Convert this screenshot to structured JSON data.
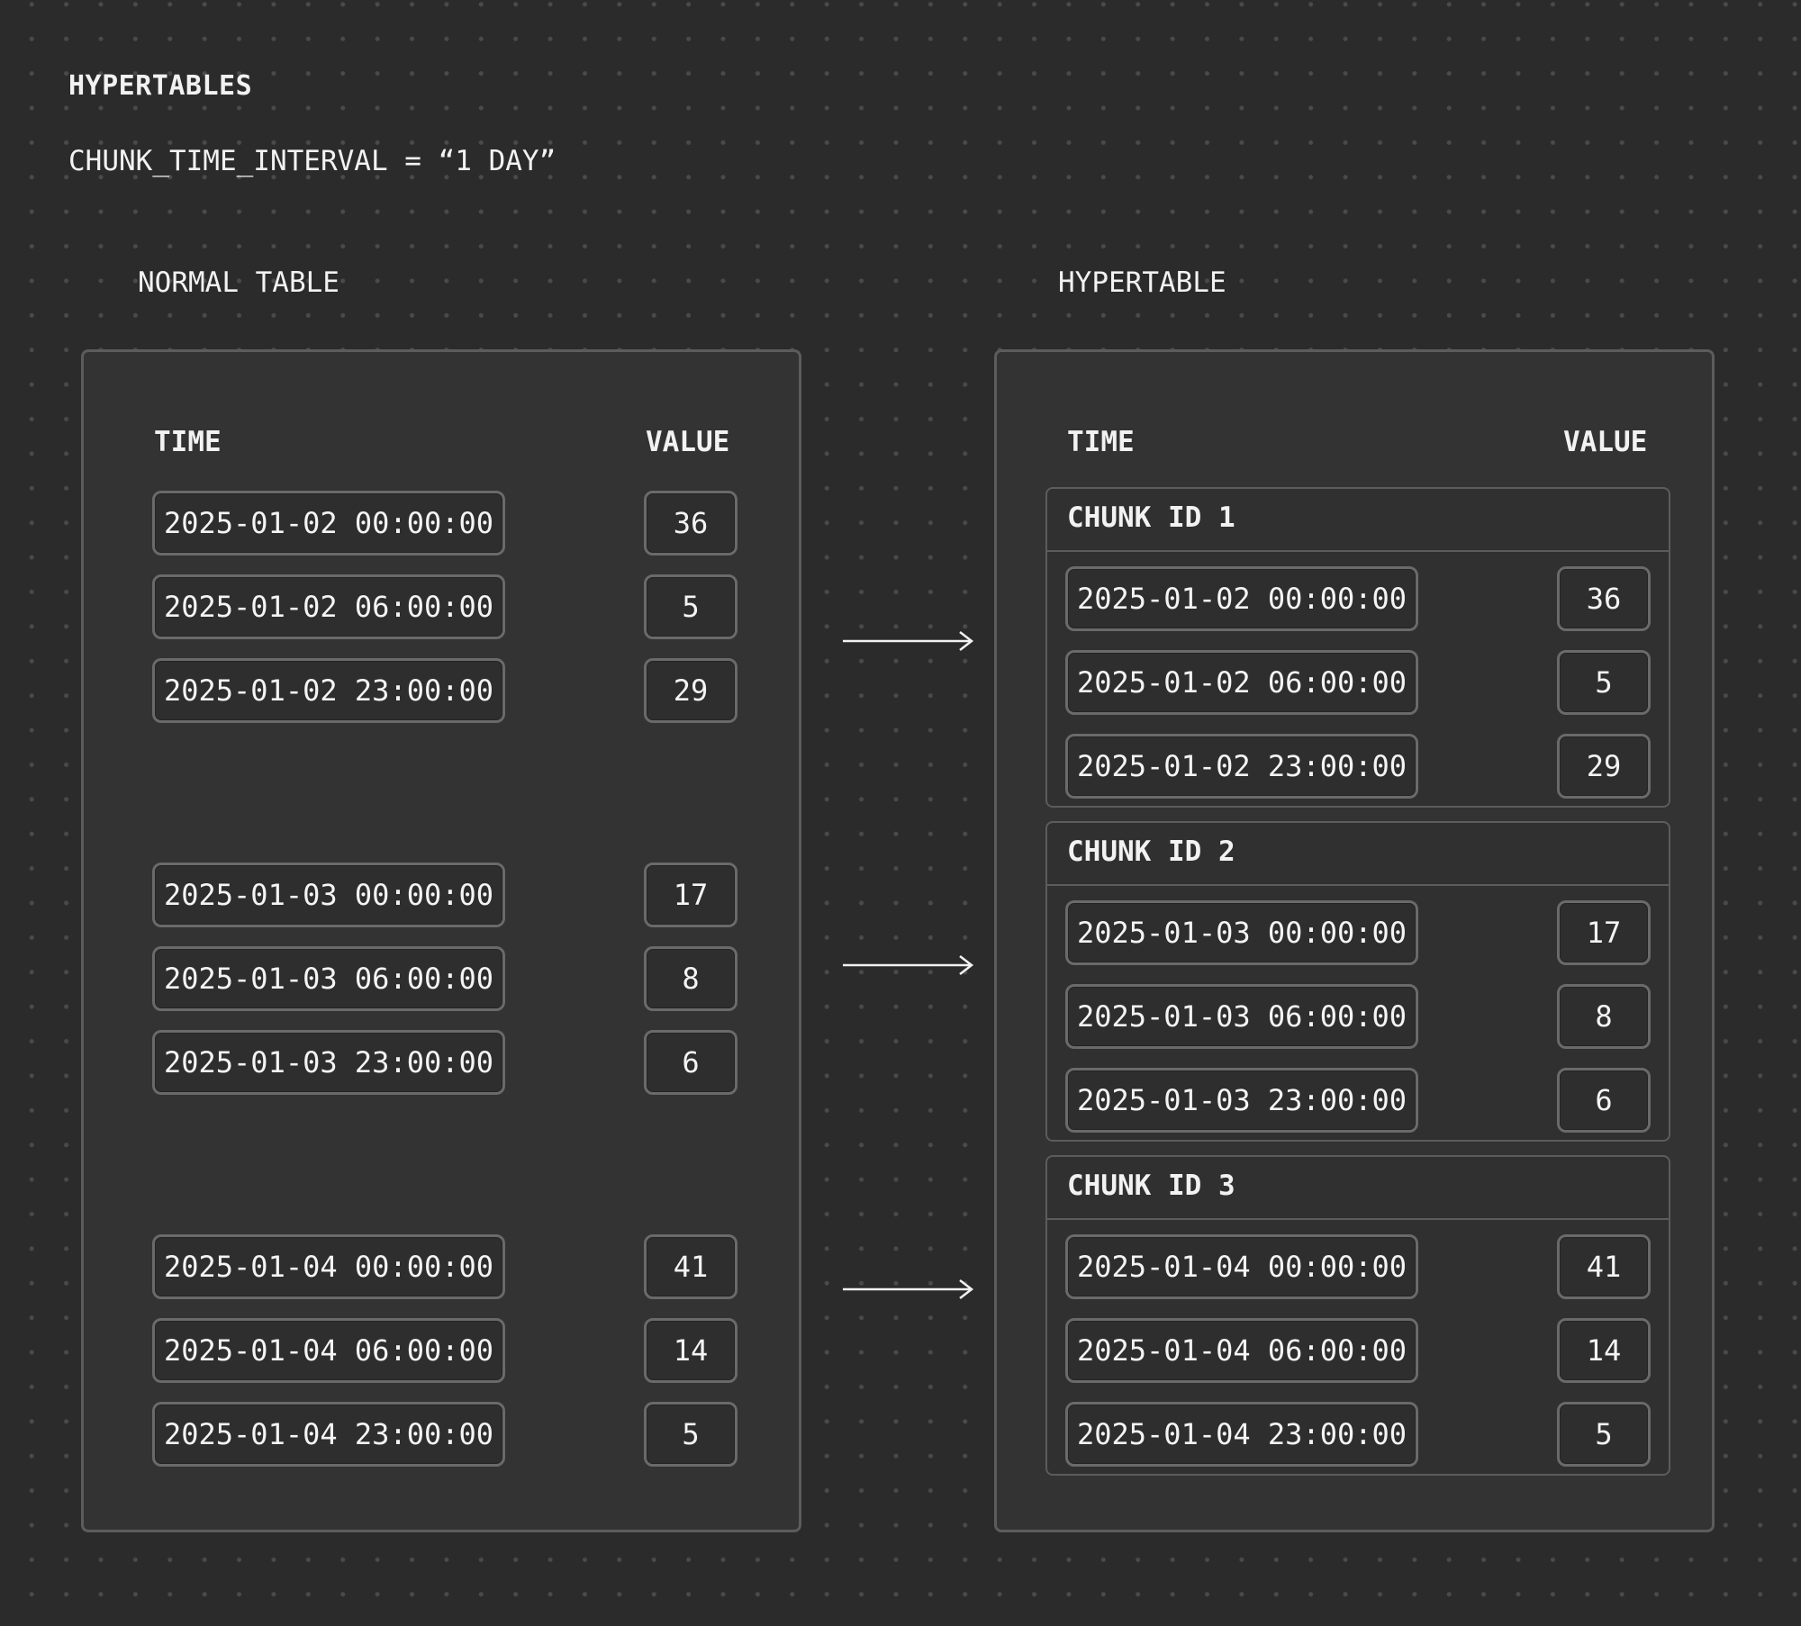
{
  "header": {
    "title": "HYPERTABLES",
    "subtitle": "CHUNK_TIME_INTERVAL = “1 DAY”"
  },
  "normal_table": {
    "label": "NORMAL TABLE",
    "col_time": "TIME",
    "col_value": "VALUE",
    "rows": [
      {
        "time": "2025-01-02 00:00:00",
        "value": "36"
      },
      {
        "time": "2025-01-02 06:00:00",
        "value": "5"
      },
      {
        "time": "2025-01-02 23:00:00",
        "value": "29"
      },
      {
        "time": "2025-01-03 00:00:00",
        "value": "17"
      },
      {
        "time": "2025-01-03 06:00:00",
        "value": "8"
      },
      {
        "time": "2025-01-03 23:00:00",
        "value": "6"
      },
      {
        "time": "2025-01-04 00:00:00",
        "value": "41"
      },
      {
        "time": "2025-01-04 06:00:00",
        "value": "14"
      },
      {
        "time": "2025-01-04 23:00:00",
        "value": "5"
      }
    ]
  },
  "hypertable": {
    "label": "HYPERTABLE",
    "col_time": "TIME",
    "col_value": "VALUE",
    "chunks": [
      {
        "title": "CHUNK ID 1",
        "rows": [
          {
            "time": "2025-01-02 00:00:00",
            "value": "36"
          },
          {
            "time": "2025-01-02 06:00:00",
            "value": "5"
          },
          {
            "time": "2025-01-02 23:00:00",
            "value": "29"
          }
        ]
      },
      {
        "title": "CHUNK ID 2",
        "rows": [
          {
            "time": "2025-01-03 00:00:00",
            "value": "17"
          },
          {
            "time": "2025-01-03 06:00:00",
            "value": "8"
          },
          {
            "time": "2025-01-03 23:00:00",
            "value": "6"
          }
        ]
      },
      {
        "title": "CHUNK ID 3",
        "rows": [
          {
            "time": "2025-01-04 00:00:00",
            "value": "41"
          },
          {
            "time": "2025-01-04 06:00:00",
            "value": "14"
          },
          {
            "time": "2025-01-04 23:00:00",
            "value": "5"
          }
        ]
      }
    ]
  },
  "arrows": [
    {
      "icon": "arrow-right-icon"
    },
    {
      "icon": "arrow-right-icon"
    },
    {
      "icon": "arrow-right-icon"
    }
  ],
  "colors": {
    "background": "#2b2b2b",
    "panel": "#333333",
    "border": "#5c5c5c",
    "text": "#f2f2f2"
  }
}
